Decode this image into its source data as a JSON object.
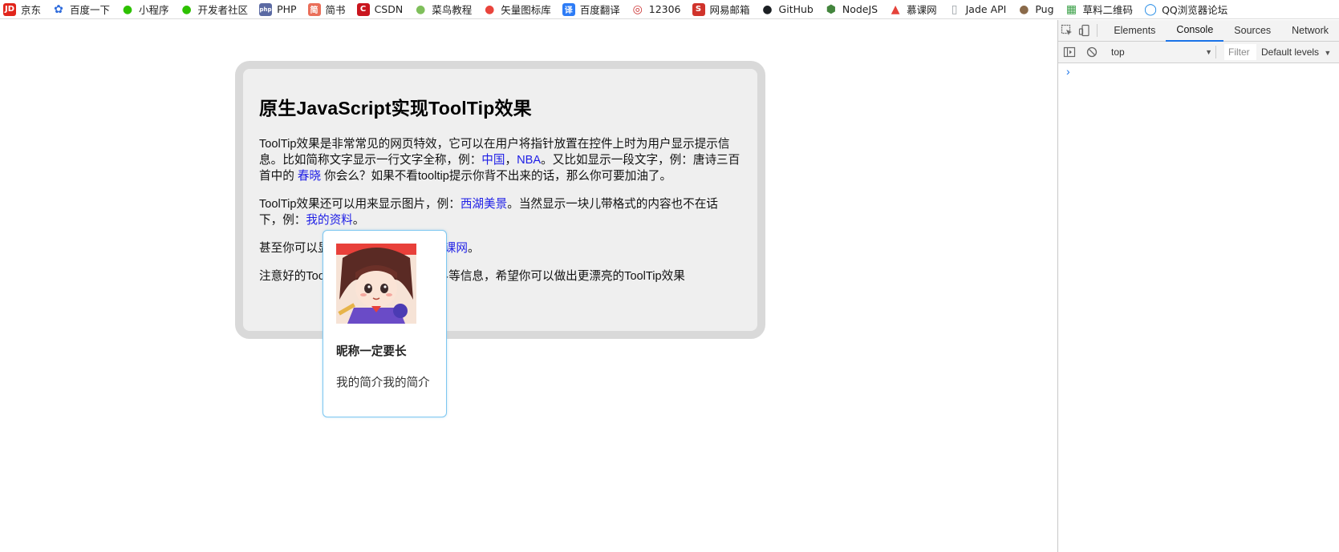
{
  "bookmarks": [
    {
      "label": "京东",
      "icon": "jd-icon",
      "color": "#e1251b",
      "glyph": "JD"
    },
    {
      "label": "百度一下",
      "icon": "baidu-paw-icon",
      "color": "#2e6bdc",
      "glyph": "✿"
    },
    {
      "label": "小程序",
      "icon": "wechat-icon",
      "color": "#2dc100",
      "glyph": "●"
    },
    {
      "label": "开发者社区",
      "icon": "wechat-icon",
      "color": "#2dc100",
      "glyph": "●"
    },
    {
      "label": "PHP",
      "icon": "php-icon",
      "color": "#5b6aa3",
      "glyph": "php"
    },
    {
      "label": "简书",
      "icon": "jianshu-icon",
      "color": "#ea6f5a",
      "glyph": "简"
    },
    {
      "label": "CSDN",
      "icon": "csdn-icon",
      "color": "#c9151e",
      "glyph": "C"
    },
    {
      "label": "菜鸟教程",
      "icon": "runoob-icon",
      "color": "#7fbf5b",
      "glyph": "●"
    },
    {
      "label": "矢量图标库",
      "icon": "iconfont-icon",
      "color": "#e9443c",
      "glyph": "●"
    },
    {
      "label": "百度翻译",
      "icon": "translate-icon",
      "color": "#2d7cf6",
      "glyph": "译"
    },
    {
      "label": "12306",
      "icon": "12306-icon",
      "color": "#cc3333",
      "glyph": "◎"
    },
    {
      "label": "网易邮箱",
      "icon": "netease-icon",
      "color": "#d0332b",
      "glyph": "S"
    },
    {
      "label": "GitHub",
      "icon": "github-icon",
      "color": "#1b1f23",
      "glyph": "●"
    },
    {
      "label": "NodeJS",
      "icon": "nodejs-icon",
      "color": "#43853d",
      "glyph": "⬢"
    },
    {
      "label": "慕课网",
      "icon": "imooc-flame-icon",
      "color": "#e5423a",
      "glyph": "▲"
    },
    {
      "label": "Jade API",
      "icon": "document-icon",
      "color": "#9aa0a6",
      "glyph": "▯"
    },
    {
      "label": "Pug",
      "icon": "pug-icon",
      "color": "#8a6a4a",
      "glyph": "●"
    },
    {
      "label": "草料二维码",
      "icon": "qrcode-icon",
      "color": "#3aa047",
      "glyph": "▦"
    },
    {
      "label": "QQ浏览器论坛",
      "icon": "qq-browser-icon",
      "color": "#1e88e5",
      "glyph": "◯"
    }
  ],
  "page": {
    "title": "原生JavaScript实现ToolTip效果",
    "p1": {
      "t1": "ToolTip效果是非常常见的网页特效，它可以在用户将指针放置在控件上时为用户显示提示信息。比如简称文字显示一行文字全称，例：",
      "link1": "中国",
      "sep": "，",
      "link2": "NBA",
      "t2": "。又比如显示一段文字，例：唐诗三百首中的",
      "link3": "春晓",
      "t3": "你会么？如果不看tooltip提示你背不出来的话，那么你可要加油了。"
    },
    "p2": {
      "t1": "ToolTip效果还可以用来显示图片，例：",
      "link1": "西湖美景",
      "t2": "。当然显示一块儿带格式的内容也不在话下，例：",
      "link2": "我的资料",
      "t3": "。"
    },
    "p3": {
      "t1": "甚至你可以显示",
      "link1": "慕课网",
      "t2": "。"
    },
    "p4": {
      "t1": "注意好的ToolTip效果",
      "t2": "果、页面的边界等信息，希望你可以做出更漂亮的ToolTip效果"
    }
  },
  "tooltip": {
    "nickname": "昵称一定要长",
    "intro": "我的简介我的简介"
  },
  "devtools": {
    "tabs": [
      "Elements",
      "Console",
      "Sources",
      "Network"
    ],
    "active_tab": "Console",
    "context": "top",
    "filter_placeholder": "Filter",
    "levels": "Default levels",
    "prompt": "›"
  }
}
